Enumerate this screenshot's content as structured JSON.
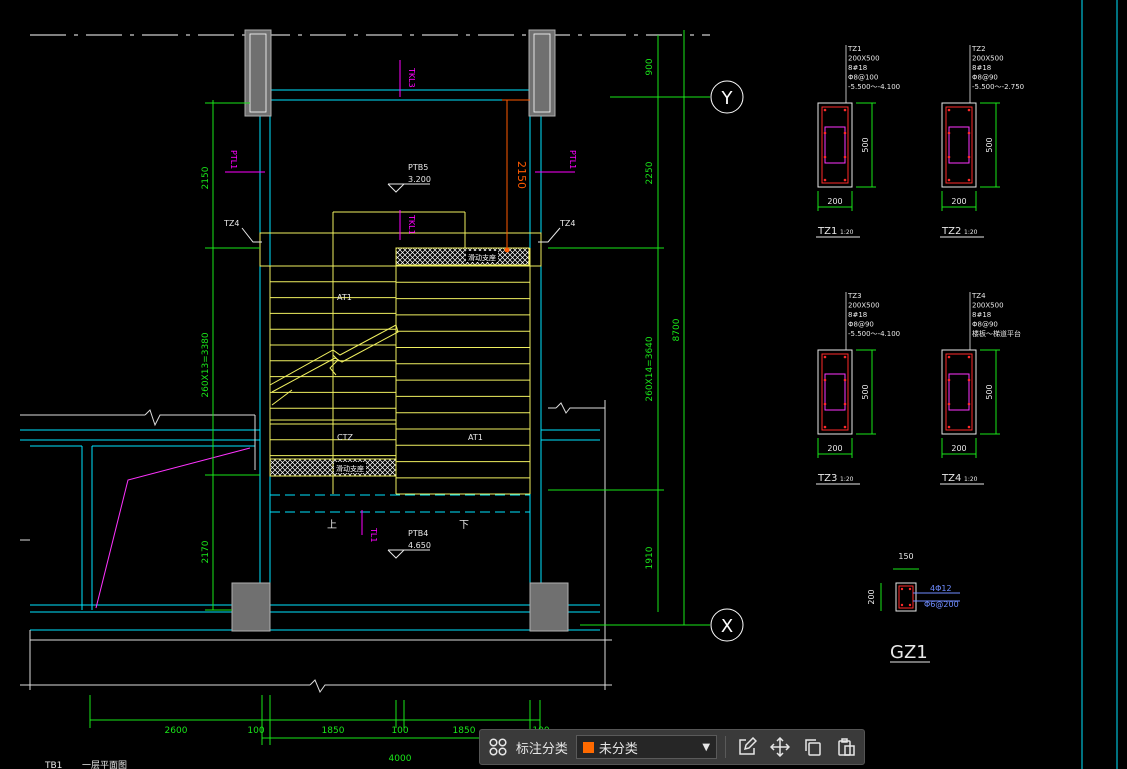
{
  "colors": {
    "background": "#000000",
    "wall": "#00e5ff",
    "stair": "#f0f060",
    "dim": "#19e619",
    "rebar": "#ff2a2a",
    "stirrup": "#ff33ff",
    "note": "#e8e8e8",
    "magenta": "#ff00ff",
    "orange": "#ff5a00",
    "column_fill": "#707070",
    "toolbar_bg": "#3a3a3a",
    "category_swatch": "#ff6a00"
  },
  "plan": {
    "axis_labels": [
      "Y",
      "X"
    ],
    "beam_labels": [
      "TKL3",
      "TKL1",
      "TL1"
    ],
    "pt_labels": [
      "PTL1",
      "PTL1"
    ],
    "column_tags": [
      "TZ4",
      "TZ4"
    ],
    "landing_top": {
      "name": "PTB5",
      "elev": "3.200"
    },
    "landing_bottom": {
      "name": "PTB4",
      "elev": "4.650"
    },
    "flight_labels": [
      "AT1",
      "CTZ",
      "AT1"
    ],
    "hatch_labels": [
      "滑动支座",
      "滑动支座"
    ],
    "up_down": [
      "上",
      "下"
    ],
    "orange_dim": "2150",
    "left_dims": [
      "2150",
      "260X13=3380",
      "2170"
    ],
    "right_dims": [
      "900",
      "2250",
      "260X14=3640",
      "1910",
      "8700"
    ],
    "bottom_dims": [
      "2600",
      "100",
      "1850",
      "100",
      "1850",
      "100"
    ],
    "overall_dim": "4000",
    "footer_caption": "一层平面图",
    "footer_tag": "TB1"
  },
  "columns": [
    {
      "id": "TZ1",
      "section": "200X500",
      "bars1": "8#18",
      "bars2": "Φ8@100",
      "range": "-5.500～-4.100",
      "dim_h": "500",
      "dim_b": "200",
      "title": "TZ1",
      "scale": "1:20"
    },
    {
      "id": "TZ2",
      "section": "200X500",
      "bars1": "8#18",
      "bars2": "Φ8@90",
      "range": "-5.500～-2.750",
      "dim_h": "500",
      "dim_b": "200",
      "title": "TZ2",
      "scale": "1:20"
    },
    {
      "id": "TZ3",
      "section": "200X500",
      "bars1": "8#18",
      "bars2": "Φ8@90",
      "range": "-5.500～-4.100",
      "dim_h": "500",
      "dim_b": "200",
      "title": "TZ3",
      "scale": "1:20"
    },
    {
      "id": "TZ4",
      "section": "200X500",
      "bars1": "8#18",
      "bars2": "Φ8@90",
      "range": "楼板～梯道平台",
      "dim_h": "500",
      "dim_b": "200",
      "title": "TZ4",
      "scale": "1:20"
    }
  ],
  "gz1": {
    "title": "GZ1",
    "dim_w": "150",
    "dim_h": "200",
    "bars": "4Φ12",
    "stirrup": "Φ6@200"
  },
  "toolbar": {
    "label": "标注分类",
    "dropdown_value": "未分类"
  }
}
